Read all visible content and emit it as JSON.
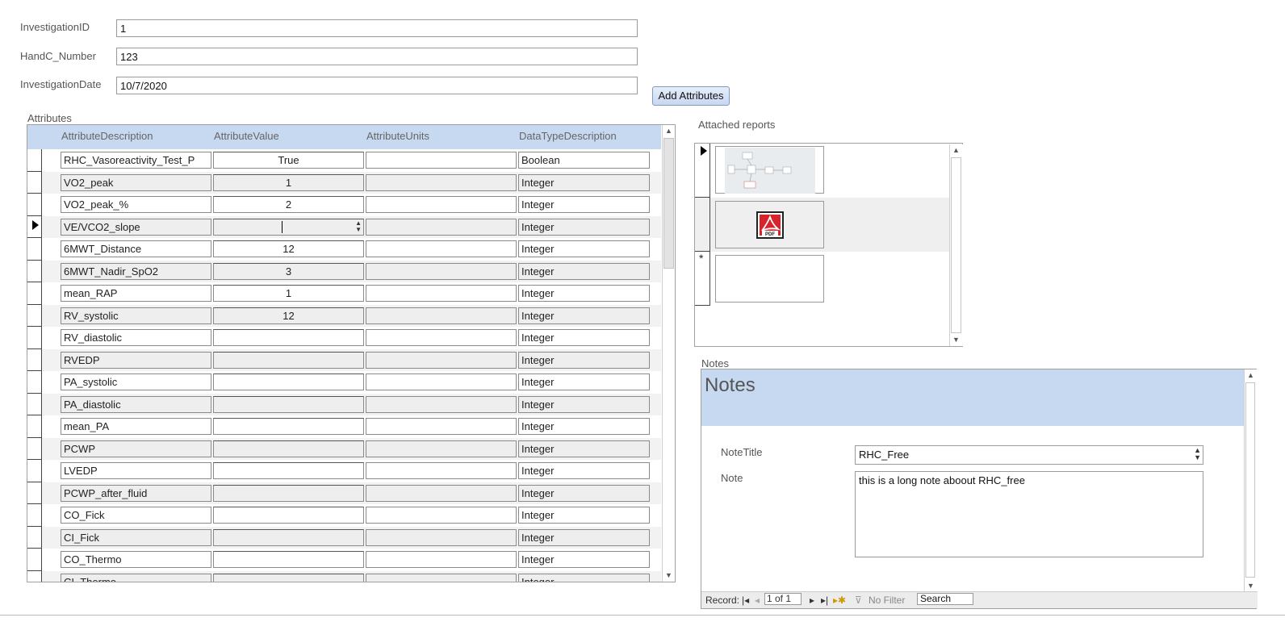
{
  "form": {
    "investigation_id_label": "InvestigationID",
    "investigation_id_value": "1",
    "handc_label": "HandC_Number",
    "handc_value": "123",
    "date_label": "InvestigationDate",
    "date_value": "10/7/2020",
    "add_attributes_label": "Add Attributes"
  },
  "attributes": {
    "title": "Attributes",
    "columns": [
      "AttributeDescription",
      "AttributeValue",
      "AttributeUnits",
      "DataTypeDescription"
    ],
    "rows": [
      {
        "desc": "RHC_Vasoreactivity_Test_P",
        "value": "True",
        "units": "",
        "type": "Boolean"
      },
      {
        "desc": "VO2_peak",
        "value": "1",
        "units": "",
        "type": "Integer"
      },
      {
        "desc": "VO2_peak_%",
        "value": "2",
        "units": "",
        "type": "Integer"
      },
      {
        "desc": "VE/VCO2_slope",
        "value": "",
        "units": "",
        "type": "Integer",
        "current": true
      },
      {
        "desc": "6MWT_Distance",
        "value": "12",
        "units": "",
        "type": "Integer"
      },
      {
        "desc": "6MWT_Nadir_SpO2",
        "value": "3",
        "units": "",
        "type": "Integer"
      },
      {
        "desc": "mean_RAP",
        "value": "1",
        "units": "",
        "type": "Integer"
      },
      {
        "desc": "RV_systolic",
        "value": "12",
        "units": "",
        "type": "Integer"
      },
      {
        "desc": "RV_diastolic",
        "value": "",
        "units": "",
        "type": "Integer"
      },
      {
        "desc": "RVEDP",
        "value": "",
        "units": "",
        "type": "Integer"
      },
      {
        "desc": "PA_systolic",
        "value": "",
        "units": "",
        "type": "Integer"
      },
      {
        "desc": "PA_diastolic",
        "value": "",
        "units": "",
        "type": "Integer"
      },
      {
        "desc": "mean_PA",
        "value": "",
        "units": "",
        "type": "Integer"
      },
      {
        "desc": "PCWP",
        "value": "",
        "units": "",
        "type": "Integer"
      },
      {
        "desc": "LVEDP",
        "value": "",
        "units": "",
        "type": "Integer"
      },
      {
        "desc": "PCWP_after_fluid",
        "value": "",
        "units": "",
        "type": "Integer"
      },
      {
        "desc": "CO_Fick",
        "value": "",
        "units": "",
        "type": "Integer"
      },
      {
        "desc": "CI_Fick",
        "value": "",
        "units": "",
        "type": "Integer"
      },
      {
        "desc": "CO_Thermo",
        "value": "",
        "units": "",
        "type": "Integer"
      },
      {
        "desc": "CI_Thermo",
        "value": "",
        "units": "",
        "type": "Integer"
      }
    ]
  },
  "attachments": {
    "title": "Attached reports",
    "pdf_text": "PDF",
    "new_record_marker": "*"
  },
  "notes": {
    "section_label": "Notes",
    "header_title": "Notes",
    "note_title_label": "NoteTitle",
    "note_title_value": "RHC_Free",
    "note_label": "Note",
    "note_value": "this is a long note aboout RHC_free",
    "nav": {
      "record_label": "Record:",
      "record_position": "1 of 1",
      "filter_label": "No Filter",
      "search_label": "Search"
    }
  },
  "colors": {
    "header_blue": "#c6d9f0",
    "button_blue": "#c8d8f0"
  }
}
